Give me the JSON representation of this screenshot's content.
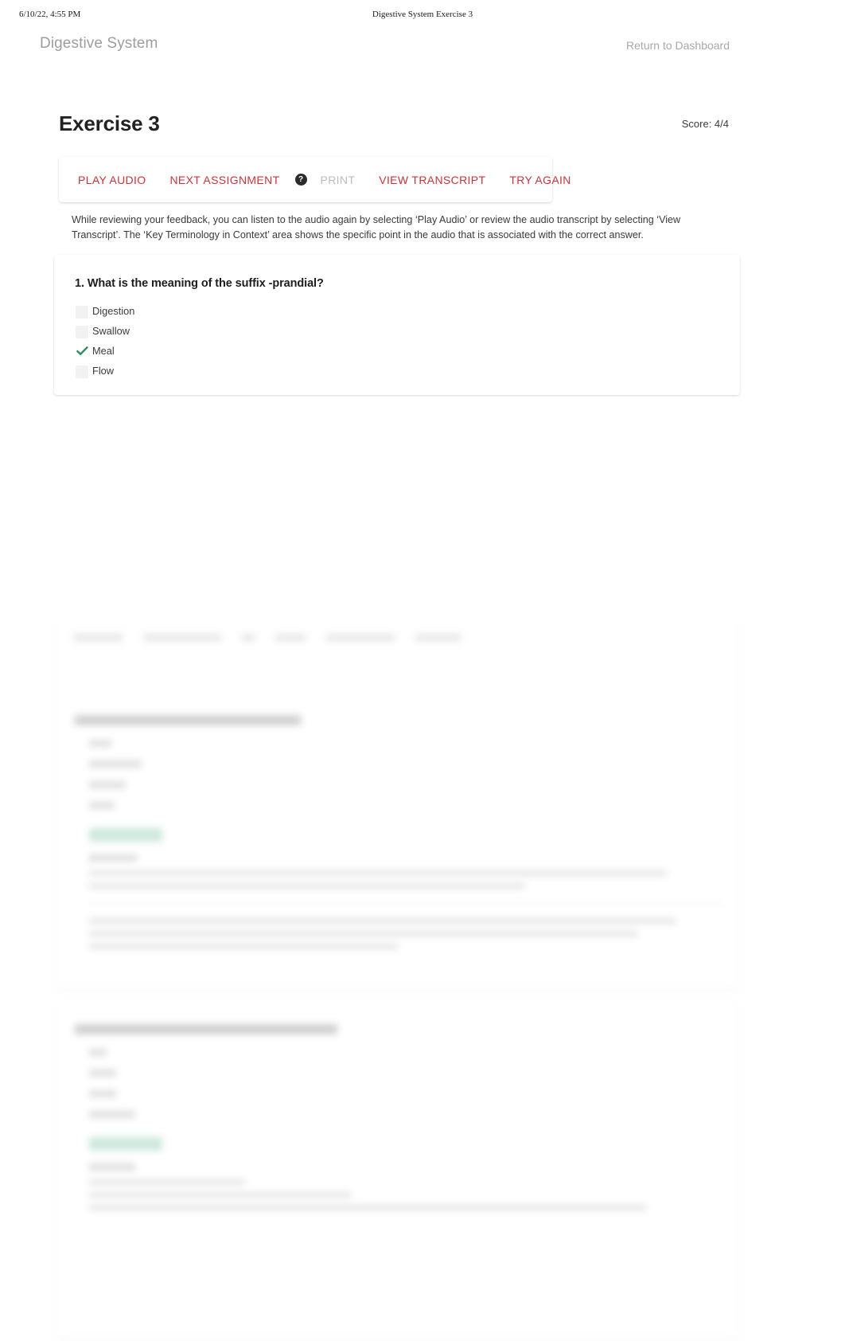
{
  "print_header": {
    "date": "6/10/22, 4:55 PM",
    "title": "Digestive System Exercise 3"
  },
  "appbar": {
    "brand": "Digestive System",
    "dashboard_link": "Return to Dashboard"
  },
  "page": {
    "title": "Exercise 3",
    "score_label": "Score: 4/4"
  },
  "toolbar": {
    "play_audio": "PLAY AUDIO",
    "next_assignment": "NEXT ASSIGNMENT",
    "help_icon": "?",
    "print": "PRINT",
    "view_transcript": "VIEW TRANSCRIPT",
    "try_again": "TRY AGAIN"
  },
  "instructions": {
    "text": "While reviewing your feedback, you can listen to the audio again by selecting ‘Play Audio’ or review the audio transcript by selecting ‘View Transcript’. The ‘Key Terminology in Context’ area shows the specific point in the audio that is associated with the correct answer."
  },
  "questions": [
    {
      "number": "1.",
      "text": "1. What is the meaning of the suffix -prandial?",
      "options": [
        {
          "label": "Digestion",
          "selected": false
        },
        {
          "label": "Swallow",
          "selected": false
        },
        {
          "label": "Meal",
          "selected": true
        },
        {
          "label": "Flow",
          "selected": false
        }
      ]
    }
  ],
  "colors": {
    "accent_red": "#c7343a",
    "correct_green": "#2e8b5f",
    "badge_green": "#b7ddcd",
    "muted_gray": "#9e9e9e"
  }
}
